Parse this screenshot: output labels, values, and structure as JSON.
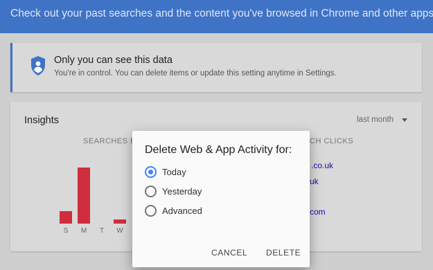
{
  "banner": {
    "text": "Check out your past searches and the content you've browsed in Chrome and other apps"
  },
  "privacy": {
    "icon": "shield-person-icon",
    "title": "Only you can see this data",
    "subtitle": "You're in control. You can delete items or update this setting anytime in Settings."
  },
  "insights": {
    "title": "Insights",
    "range": "last month",
    "col_left": "SEARCHES B",
    "col_right": "CH CLICKS",
    "links": [
      ".co.uk",
      "uk",
      "com"
    ],
    "chart_data": {
      "type": "bar",
      "categories": [
        "S",
        "M",
        "T",
        "W"
      ],
      "values": [
        18,
        81,
        0,
        6
      ],
      "ylim": [
        0,
        85
      ]
    }
  },
  "colors": {
    "banner": "#3f73c6",
    "bar": "#cf2e3e",
    "radio_accent": "#4285f4"
  },
  "dialog": {
    "title": "Delete Web & App Activity for:",
    "options": [
      {
        "label": "Today",
        "checked": true
      },
      {
        "label": "Yesterday",
        "checked": false
      },
      {
        "label": "Advanced",
        "checked": false
      }
    ],
    "cancel_label": "CANCEL",
    "delete_label": "DELETE"
  }
}
